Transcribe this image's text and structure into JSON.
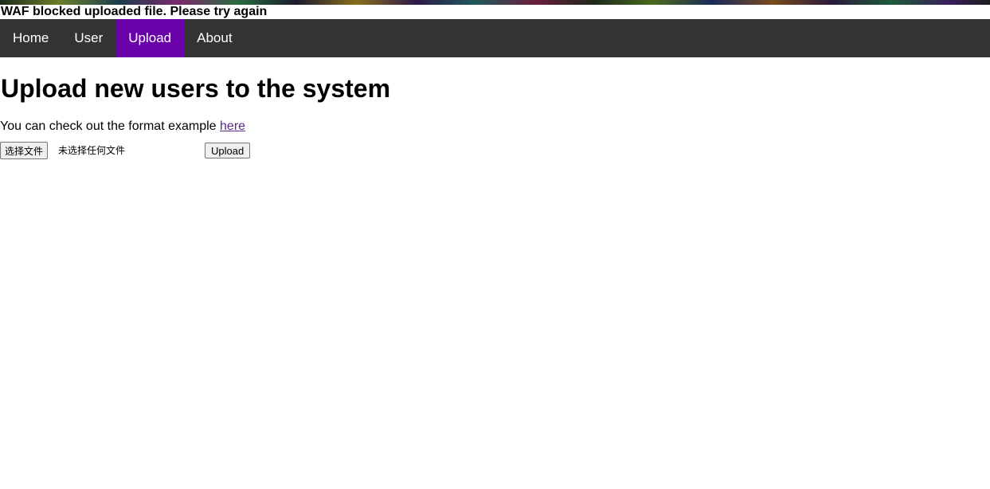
{
  "banner": {
    "message": "WAF blocked uploaded file. Please try again"
  },
  "nav": {
    "items": [
      {
        "label": "Home",
        "active": false
      },
      {
        "label": "User",
        "active": false
      },
      {
        "label": "Upload",
        "active": true
      },
      {
        "label": "About",
        "active": false
      }
    ]
  },
  "main": {
    "title": "Upload new users to the system",
    "format_text": "You can check out the format example ",
    "format_link": "here"
  },
  "upload_form": {
    "choose_file_label": "选择文件",
    "no_file_text": "未选择任何文件",
    "submit_label": "Upload"
  },
  "colors": {
    "nav_background": "#333333",
    "nav_active": "#6a00a8",
    "link": "#5a2a8a"
  }
}
